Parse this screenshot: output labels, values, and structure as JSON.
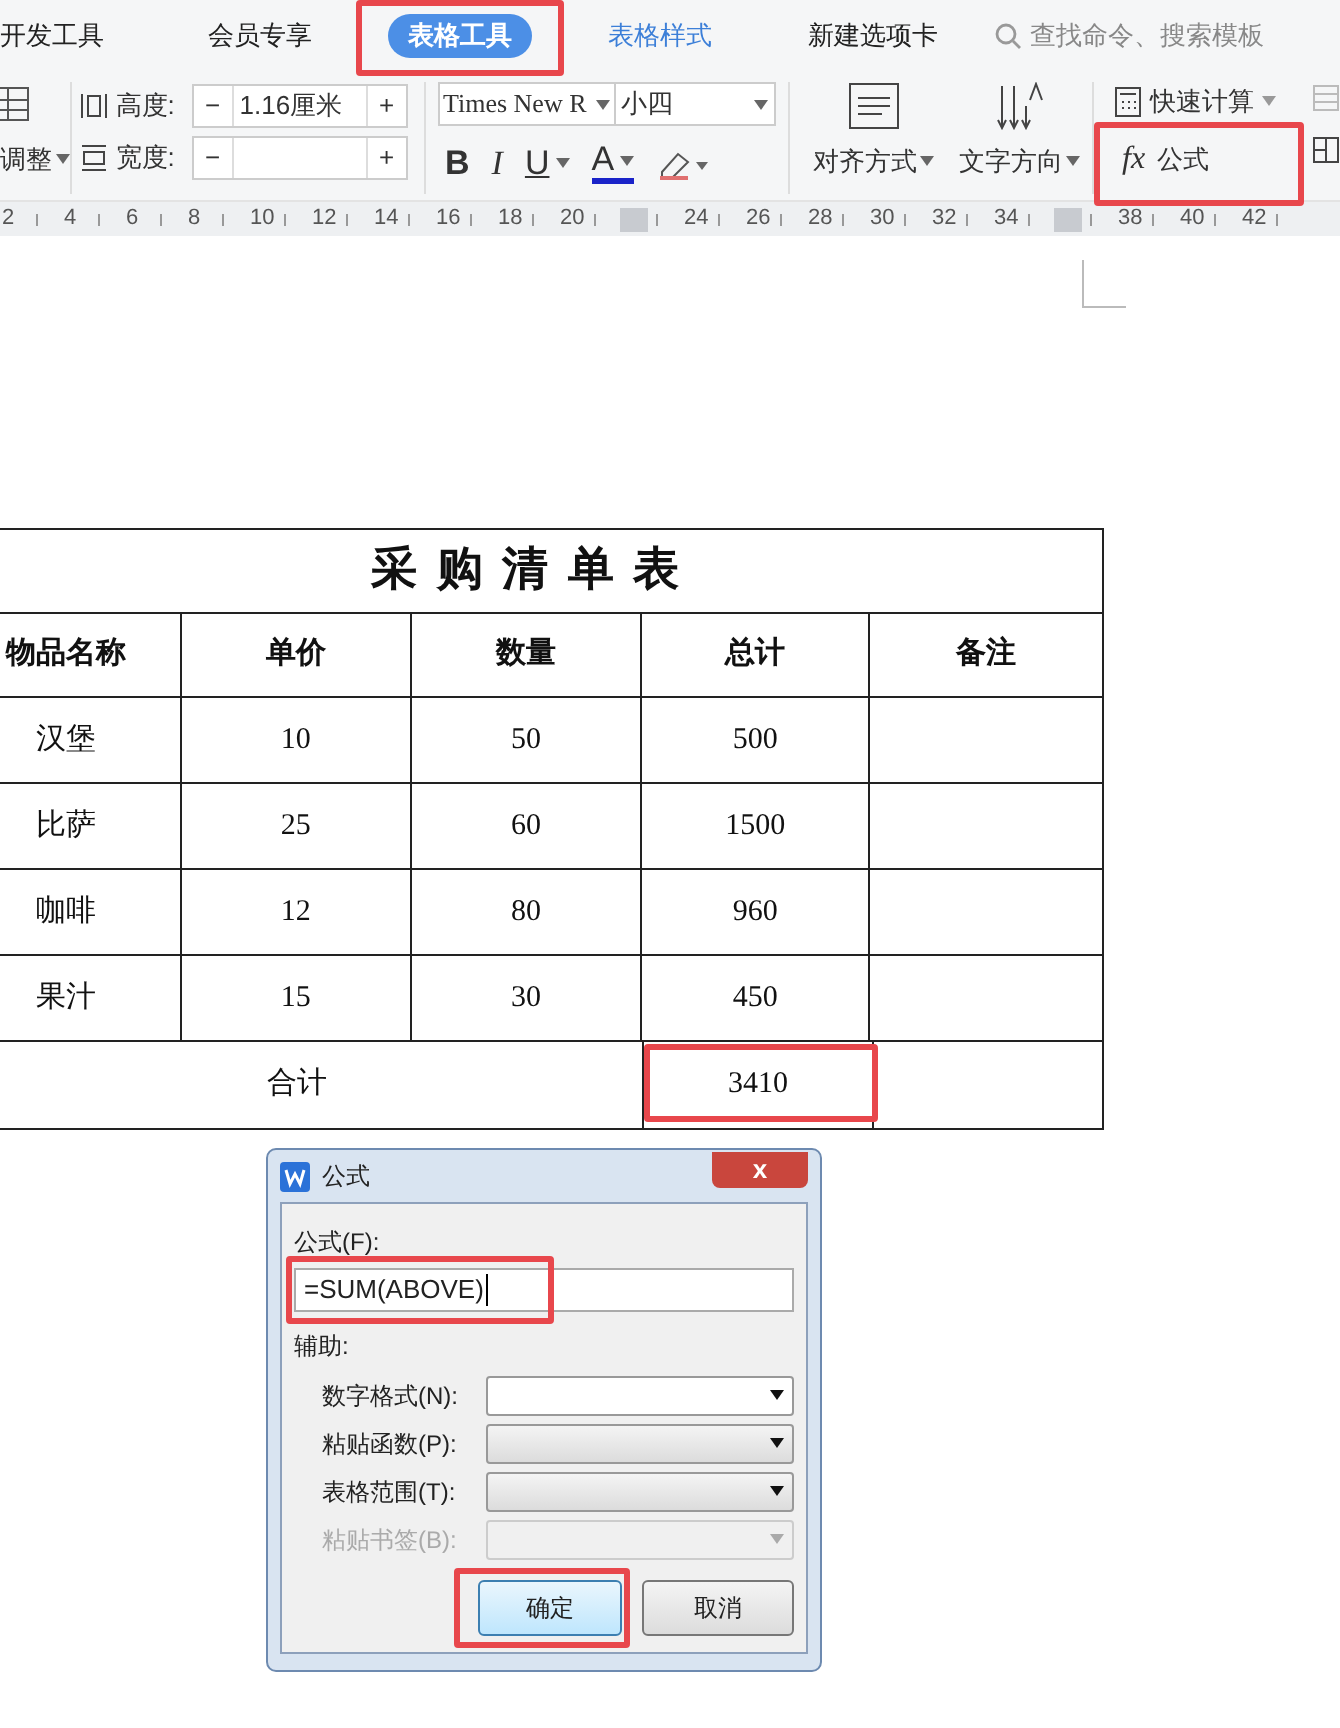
{
  "ribbon_tabs": [
    {
      "label": "开发工具",
      "selected": false,
      "highlighted": false
    },
    {
      "label": "会员专享",
      "selected": false,
      "highlighted": false
    },
    {
      "label": "表格工具",
      "selected": true,
      "highlighted": true
    },
    {
      "label": "表格样式",
      "selected": false,
      "highlighted": false,
      "kind": "link"
    },
    {
      "label": "新建选项卡",
      "selected": false,
      "highlighted": false
    }
  ],
  "search": {
    "placeholder": "查找命令、搜索模板"
  },
  "toolbar": {
    "adjust_label": "调整",
    "height_label": "高度:",
    "height_value": "1.16厘米",
    "width_label": "宽度:",
    "minus": "−",
    "plus": "+",
    "font_name": "Times New R",
    "font_size": "小四",
    "bold": "B",
    "italic": "I",
    "underline": "U",
    "font_color": "A",
    "align_label": "对齐方式",
    "direction_label": "文字方向",
    "quick_calc": "快速计算",
    "formula_label": "公式",
    "formula_fx": "fx",
    "formula_highlighted": true
  },
  "ruler": [
    {
      "kind": "number",
      "label": "2"
    },
    {
      "kind": "number",
      "label": "4"
    },
    {
      "kind": "number",
      "label": "6"
    },
    {
      "kind": "number",
      "label": "8"
    },
    {
      "kind": "number",
      "label": "10"
    },
    {
      "kind": "number",
      "label": "12"
    },
    {
      "kind": "number",
      "label": "14"
    },
    {
      "kind": "number",
      "label": "16"
    },
    {
      "kind": "number",
      "label": "18"
    },
    {
      "kind": "number",
      "label": "20"
    },
    {
      "kind": "marker"
    },
    {
      "kind": "number",
      "label": "24"
    },
    {
      "kind": "number",
      "label": "26"
    },
    {
      "kind": "number",
      "label": "28"
    },
    {
      "kind": "number",
      "label": "30"
    },
    {
      "kind": "number",
      "label": "32"
    },
    {
      "kind": "number",
      "label": "34"
    },
    {
      "kind": "marker"
    },
    {
      "kind": "number",
      "label": "38"
    },
    {
      "kind": "number",
      "label": "40"
    },
    {
      "kind": "number",
      "label": "42"
    }
  ],
  "table": {
    "title": "采 购 清 单 表",
    "columns": [
      "物品名称",
      "单价",
      "数量",
      "总计",
      "备注"
    ],
    "rows": [
      [
        "汉堡",
        "10",
        "50",
        "500",
        ""
      ],
      [
        "比萨",
        "25",
        "60",
        "1500",
        ""
      ],
      [
        "咖啡",
        "12",
        "80",
        "960",
        ""
      ],
      [
        "果汁",
        "15",
        "30",
        "450",
        ""
      ]
    ],
    "total_label": "合计",
    "total_value": "3410",
    "total_highlighted": true
  },
  "dialog": {
    "title": "公式",
    "close": "x",
    "formula_label": "公式(F):",
    "formula_value": "=SUM(ABOVE)",
    "formula_highlighted": true,
    "helper_label": "辅助:",
    "fields": [
      {
        "label": "数字格式(N):",
        "disabled": false,
        "kind": "white"
      },
      {
        "label": "粘贴函数(P):",
        "disabled": false,
        "kind": "gray"
      },
      {
        "label": "表格范围(T):",
        "disabled": false,
        "kind": "gray"
      },
      {
        "label": "粘贴书签(B):",
        "disabled": true,
        "kind": "gray"
      }
    ],
    "ok": "确定",
    "ok_highlighted": true,
    "cancel": "取消"
  }
}
